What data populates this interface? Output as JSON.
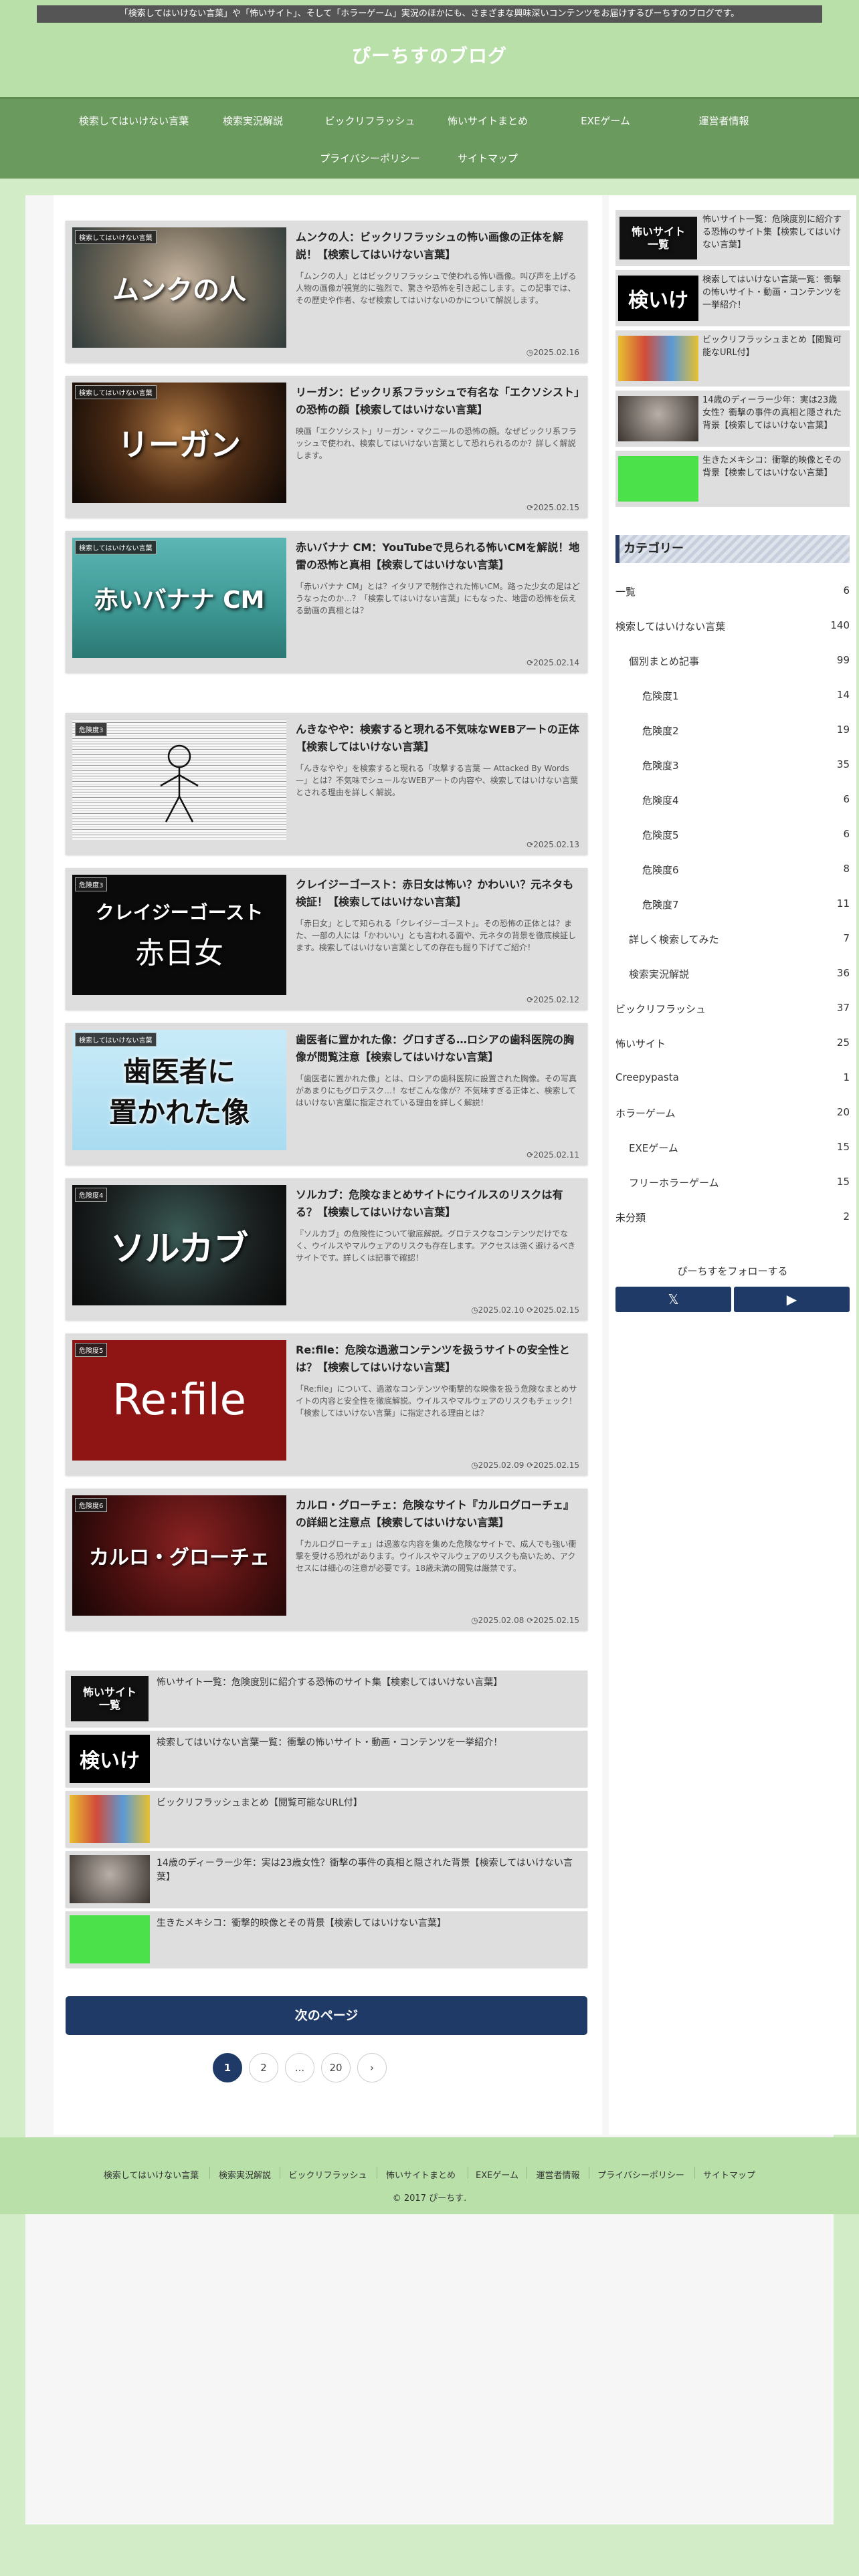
{
  "header": {
    "notice": "「検索してはいけない言葉」や「怖いサイト」、そして「ホラーゲーム」実況のほかにも、さまざまな興味深いコンテンツをお届けするぴーちすのブログです。",
    "site_title": "ぴーちすのブログ"
  },
  "nav": {
    "items": [
      "検索してはいけない言葉",
      "検索実況解説",
      "ビックリフラッシュ",
      "怖いサイトまとめ",
      "EXEゲーム",
      "運営者情報",
      "プライバシーポリシー",
      "サイトマップ"
    ]
  },
  "posts": [
    {
      "tag": "検索してはいけない言葉",
      "thumb": "ムンクの人",
      "title": "ムンクの人：ビックリフラッシュの怖い画像の正体を解説！【検索してはいけない言葉】",
      "excerpt": "「ムンクの人」とはビックリフラッシュで使われる怖い画像。叫び声を上げる人物の画像が視覚的に強烈で、驚きや恐怖を引き起こします。この記事では、その歴史や作者、なぜ検索してはいけないのかについて解説します。",
      "date": "2025.02.16",
      "updated": ""
    },
    {
      "tag": "検索してはいけない言葉",
      "thumb": "リーガン",
      "title": "リーガン：ビックリ系フラッシュで有名な「エクソシスト」の恐怖の顔【検索してはいけない言葉】",
      "excerpt": "映画「エクソシスト」リーガン・マクニールの恐怖の顔。なぜビックリ系フラッシュで使われ、検索してはいけない言葉として恐れられるのか？詳しく解説します。",
      "date": "",
      "updated": "2025.02.15"
    },
    {
      "tag": "検索してはいけない言葉",
      "thumb": "赤いバナナ CM",
      "title": "赤いバナナ CM：YouTubeで見られる怖いCMを解説！地雷の恐怖と真相【検索してはいけない言葉】",
      "excerpt": "「赤いバナナ CM」とは？イタリアで制作された怖いCM。路った少女の足はどうなったのか…？「検索してはいけない言葉」にもなった、地雷の恐怖を伝える動画の真相とは？",
      "date": "",
      "updated": "2025.02.14"
    },
    {
      "tag": "危険度3",
      "thumb": "",
      "title": "んきなやや：検索すると現れる不気味なWEBアートの正体【検索してはいけない言葉】",
      "excerpt": "「んきなやや」を検索すると現れる「攻撃する言葉 — Attacked By Words —」とは？不気味でシュールなWEBアートの内容や、検索してはいけない言葉とされる理由を詳しく解説。",
      "date": "",
      "updated": "2025.02.13"
    },
    {
      "tag": "危険度3",
      "thumb": "クレイジーゴースト",
      "thumb2": "赤日女",
      "title": "クレイジーゴースト：赤日女は怖い？かわいい？元ネタも検証！【検索してはいけない言葉】",
      "excerpt": "「赤日女」として知られる「クレイジーゴースト」。その恐怖の正体とは？また、一部の人には「かわいい」とも言われる面や、元ネタの背景を徹底検証します。検索してはいけない言葉としての存在も掘り下げてご紹介！",
      "date": "",
      "updated": "2025.02.12"
    },
    {
      "tag": "検索してはいけない言葉",
      "thumb": "歯医者に",
      "thumb2": "置かれた像",
      "title": "歯医者に置かれた像：グロすぎる…ロシアの歯科医院の胸像が閲覧注意【検索してはいけない言葉】",
      "excerpt": "「歯医者に置かれた像」とは、ロシアの歯科医院に設置された胸像。その写真があまりにもグロテスク…！なぜこんな像が？不気味すぎる正体と、検索してはいけない言葉に指定されている理由を詳しく解説！",
      "date": "",
      "updated": "2025.02.11"
    },
    {
      "tag": "危険度4",
      "thumb": "ソルカブ",
      "title": "ソルカブ：危険なまとめサイトにウイルスのリスクは有る？【検索してはいけない言葉】",
      "excerpt": "『ソルカブ』の危険性について徹底解説。グロテスクなコンテンツだけでなく、ウイルスやマルウェアのリスクも存在します。アクセスは強く避けるべきサイトです。詳しくは記事で確認！",
      "date": "2025.02.10",
      "updated": "2025.02.15"
    },
    {
      "tag": "危険度5",
      "thumb": "Re:file",
      "title": "Re:file：危険な過激コンテンツを扱うサイトの安全性とは？【検索してはいけない言葉】",
      "excerpt": "「Re:file」について、過激なコンテンツや衝撃的な映像を扱う危険なまとめサイトの内容と安全性を徹底解説。ウイルスやマルウェアのリスクもチェック！「検索してはいけない言葉」に指定される理由とは？",
      "date": "2025.02.09",
      "updated": "2025.02.15"
    },
    {
      "tag": "危険度6",
      "thumb": "カルロ・グローチェ",
      "title": "カルロ・グローチェ：危険なサイト『カルログローチェ』の詳細と注意点【検索してはいけない言葉】",
      "excerpt": "「カルログローチェ」は過激な内容を集めた危険なサイトで、成人でも強い衝撃を受ける恐れがあります。ウイルスやマルウェアのリスクも高いため、アクセスには細心の注意が必要です。18歳未満の閲覧は厳禁です。",
      "date": "2025.02.08",
      "updated": "2025.02.15"
    }
  ],
  "related": [
    {
      "thumb": "怖いサイト一覧",
      "title": "怖いサイト一覧：危険度別に紹介する恐怖のサイト集【検索してはいけない言葉】"
    },
    {
      "thumb": "検いけ",
      "title": "検索してはいけない言葉一覧：衝撃の怖いサイト・動画・コンテンツを一挙紹介！"
    },
    {
      "thumb": "",
      "title": "ビックリフラッシュまとめ【閲覧可能なURL付】"
    },
    {
      "thumb": "",
      "title": "14歳のディーラー少年：実は23歳女性？衝撃の事件の真相と隠された背景【検索してはいけない言葉】"
    },
    {
      "thumb": "",
      "title": "生きたメキシコ：衝撃的映像とその背景【検索してはいけない言葉】"
    }
  ],
  "sidebar_related": [
    {
      "thumb": "怖いサイト一覧",
      "title": "怖いサイト一覧：危険度別に紹介する恐怖のサイト集【検索してはいけない言葉】"
    },
    {
      "thumb": "検いけ",
      "title": "検索してはいけない言葉一覧：衝撃の怖いサイト・動画・コンテンツを一挙紹介！"
    },
    {
      "thumb": "",
      "title": "ビックリフラッシュまとめ【閲覧可能なURL付】"
    },
    {
      "thumb": "",
      "title": "14歳のディーラー少年：実は23歳女性？衝撃の事件の真相と隠された背景【検索してはいけない言葉】"
    },
    {
      "thumb": "",
      "title": "生きたメキシコ：衝撃的映像とその背景【検索してはいけない言葉】"
    }
  ],
  "pagination": {
    "next_label": "次のページ",
    "pages": [
      "1",
      "2",
      "...",
      "20",
      "›"
    ]
  },
  "categories": {
    "heading": "カテゴリー",
    "items": [
      {
        "label": "一覧",
        "count": "6"
      },
      {
        "label": "検索してはいけない言葉",
        "count": "140"
      },
      {
        "label": "個別まとめ記事",
        "count": "99"
      },
      {
        "label": "危険度1",
        "count": "14"
      },
      {
        "label": "危険度2",
        "count": "19"
      },
      {
        "label": "危険度3",
        "count": "35"
      },
      {
        "label": "危険度4",
        "count": "6"
      },
      {
        "label": "危険度5",
        "count": "6"
      },
      {
        "label": "危険度6",
        "count": "8"
      },
      {
        "label": "危険度7",
        "count": "11"
      },
      {
        "label": "詳しく検索してみた",
        "count": "7"
      },
      {
        "label": "検索実況解説",
        "count": "36"
      },
      {
        "label": "ビックリフラッシュ",
        "count": "37"
      },
      {
        "label": "怖いサイト",
        "count": "25"
      },
      {
        "label": "Creepypasta",
        "count": "1"
      },
      {
        "label": "ホラーゲーム",
        "count": "20"
      },
      {
        "label": "EXEゲーム",
        "count": "15"
      },
      {
        "label": "フリーホラーゲーム",
        "count": "15"
      },
      {
        "label": "未分類",
        "count": "2"
      }
    ]
  },
  "follow": {
    "title": "ぴーちすをフォローする",
    "x_icon": "𝕏",
    "youtube_icon": "▶"
  },
  "footer": {
    "links": [
      "検索してはいけない言葉",
      "検索実況解説",
      "ビックリフラッシュ",
      "怖いサイトまとめ",
      "EXEゲーム",
      "運営者情報",
      "プライバシーポリシー",
      "サイトマップ"
    ],
    "copyright": "© 2017 ぴーちす."
  },
  "colors": {
    "header_bg": "#b8e0a8",
    "nav_bg": "#6b9a5e",
    "accent_navy": "#1f3a66",
    "body_bg": "#d3ecc8"
  }
}
